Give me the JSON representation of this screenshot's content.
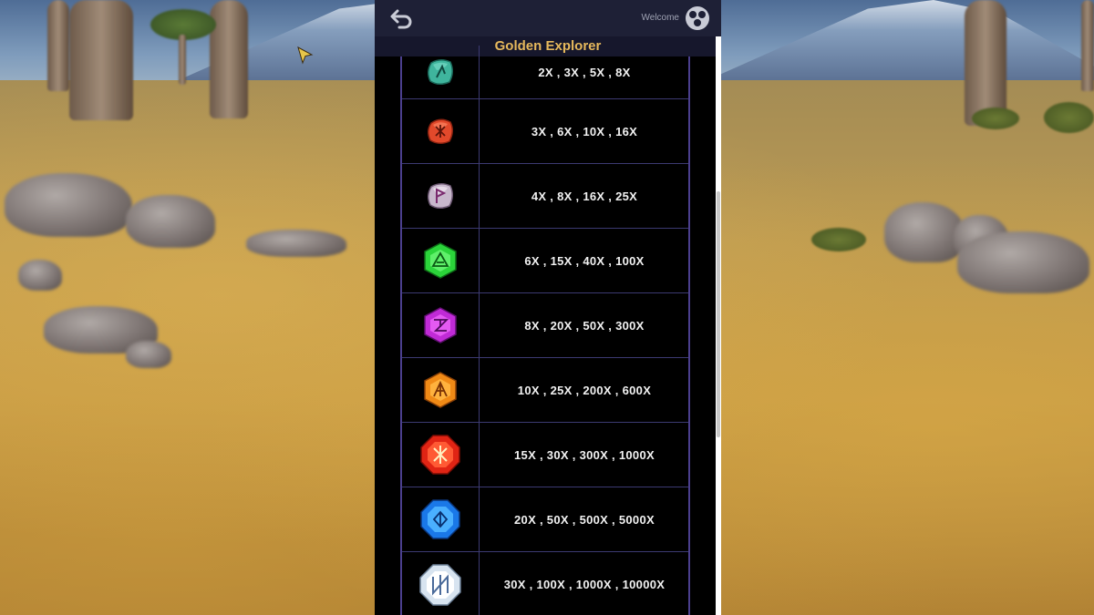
{
  "header": {
    "welcome_label": "Welcome",
    "game_title": "Golden Explorer"
  },
  "icons": {
    "back": "back-arrow-icon",
    "user": "user-avatar-icon"
  },
  "colors": {
    "title_gold": "#e6b85c",
    "panel_bg": "#000000",
    "grid_line": "#3c3a72"
  },
  "paytable": [
    {
      "symbol": "teal-rune-stone",
      "payouts": "2X , 3X , 5X , 8X"
    },
    {
      "symbol": "red-rune-stone",
      "payouts": "3X , 6X , 10X , 16X"
    },
    {
      "symbol": "lilac-rune-stone",
      "payouts": "4X , 8X , 16X , 25X"
    },
    {
      "symbol": "green-gem",
      "payouts": "6X , 15X , 40X , 100X"
    },
    {
      "symbol": "purple-gem",
      "payouts": "8X , 20X , 50X , 300X"
    },
    {
      "symbol": "orange-gem",
      "payouts": "10X , 25X , 200X , 600X"
    },
    {
      "symbol": "red-gem",
      "payouts": "15X , 30X , 300X , 1000X"
    },
    {
      "symbol": "blue-gem",
      "payouts": "20X , 50X , 500X , 5000X"
    },
    {
      "symbol": "white-diamond",
      "payouts": "30X , 100X , 1000X , 10000X"
    }
  ]
}
